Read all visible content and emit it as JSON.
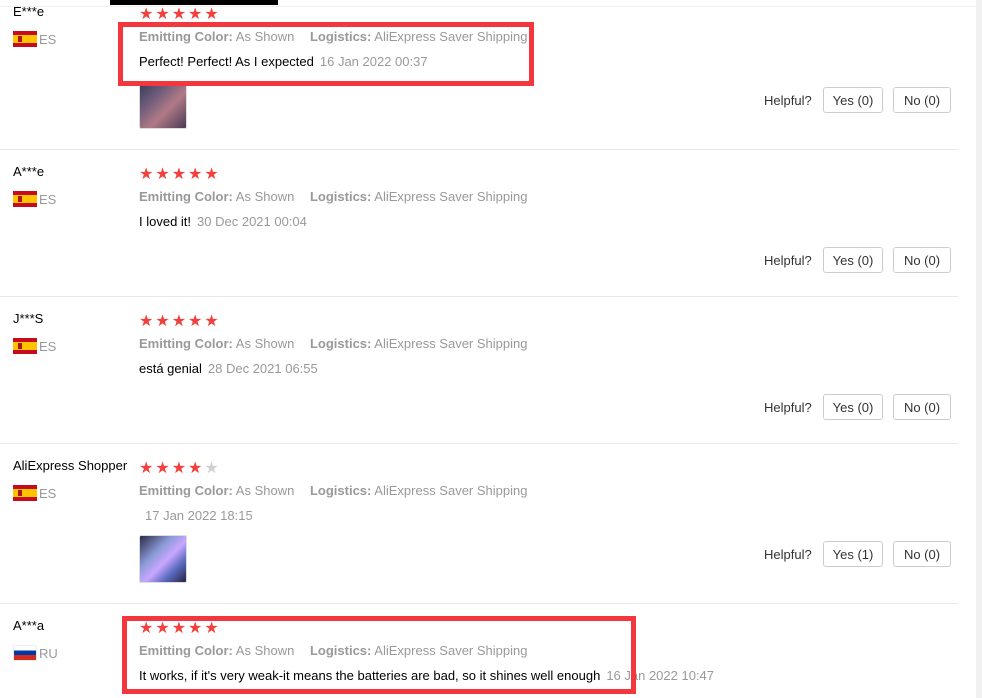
{
  "labels": {
    "emitting_color": "Emitting Color:",
    "logistics": "Logistics:",
    "helpful": "Helpful?"
  },
  "colors": {
    "star": "#f0413c",
    "highlight": "#f3373c",
    "muted_text": "#999999"
  },
  "reviews": [
    {
      "user": "E***e",
      "country": "ES",
      "rating": 5,
      "emitting_color": "As Shown",
      "logistics": "AliExpress Saver Shipping",
      "text": "Perfect! Perfect! As I expected",
      "date": "16 Jan 2022 00:37",
      "has_photo": true,
      "yes_label": "Yes (0)",
      "no_label": "No (0)"
    },
    {
      "user": "A***e",
      "country": "ES",
      "rating": 5,
      "emitting_color": "As Shown",
      "logistics": "AliExpress Saver Shipping",
      "text": "I loved it!",
      "date": "30 Dec 2021 00:04",
      "has_photo": false,
      "yes_label": "Yes (0)",
      "no_label": "No (0)"
    },
    {
      "user": "J***S",
      "country": "ES",
      "rating": 5,
      "emitting_color": "As Shown",
      "logistics": "AliExpress Saver Shipping",
      "text": "está genial",
      "date": "28 Dec 2021 06:55",
      "has_photo": false,
      "yes_label": "Yes (0)",
      "no_label": "No (0)"
    },
    {
      "user": "AliExpress Shopper",
      "country": "ES",
      "rating": 4,
      "emitting_color": "As Shown",
      "logistics": "AliExpress Saver Shipping",
      "text": "",
      "date": "17 Jan 2022 18:15",
      "has_photo": true,
      "yes_label": "Yes (1)",
      "no_label": "No (0)"
    },
    {
      "user": "A***a",
      "country": "RU",
      "rating": 5,
      "emitting_color": "As Shown",
      "logistics": "AliExpress Saver Shipping",
      "text": "It works, if it's very weak-it means the batteries are bad, so it shines well enough",
      "date": "16 Jan 2022 10:47",
      "has_photo": false
    }
  ]
}
